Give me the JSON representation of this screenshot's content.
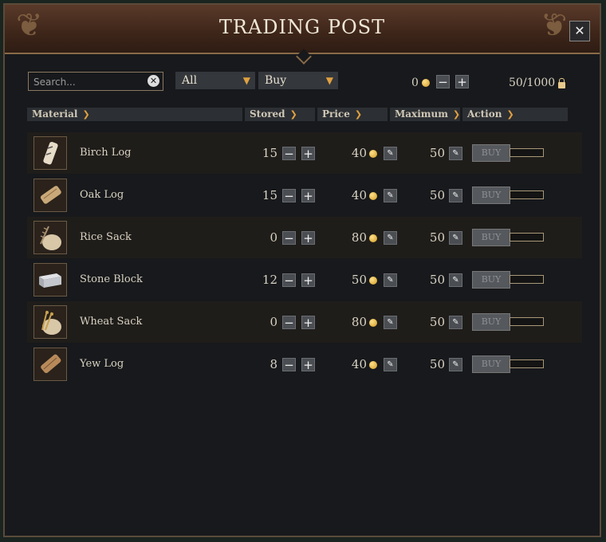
{
  "window": {
    "title": "TRADING POST",
    "close_label": "✕"
  },
  "filters": {
    "search_placeholder": "Search...",
    "search_value": "",
    "category": "All",
    "mode": "Buy"
  },
  "gold": {
    "amount": "0"
  },
  "capacity": {
    "text": "50/1000"
  },
  "columns": {
    "material": "Material",
    "stored": "Stored",
    "price": "Price",
    "maximum": "Maximum",
    "action": "Action"
  },
  "materials": [
    {
      "name": "Birch Log",
      "stored": "15",
      "price": "40",
      "maximum": "50",
      "action": "BUY",
      "slider_fraction": 0,
      "icon": "birch-log-icon"
    },
    {
      "name": "Oak Log",
      "stored": "15",
      "price": "40",
      "maximum": "50",
      "action": "BUY",
      "slider_fraction": 0,
      "icon": "oak-log-icon"
    },
    {
      "name": "Rice Sack",
      "stored": "0",
      "price": "80",
      "maximum": "50",
      "action": "BUY",
      "slider_fraction": 0,
      "icon": "rice-sack-icon"
    },
    {
      "name": "Stone Block",
      "stored": "12",
      "price": "50",
      "maximum": "50",
      "action": "BUY",
      "slider_fraction": 0,
      "icon": "stone-block-icon"
    },
    {
      "name": "Wheat Sack",
      "stored": "0",
      "price": "80",
      "maximum": "50",
      "action": "BUY",
      "slider_fraction": 0,
      "icon": "wheat-sack-icon"
    },
    {
      "name": "Yew Log",
      "stored": "8",
      "price": "40",
      "maximum": "50",
      "action": "BUY",
      "slider_fraction": 0,
      "icon": "yew-log-icon"
    }
  ],
  "colors": {
    "accent": "#e0a040",
    "title_bar": "#3d2519",
    "border": "#8a6a48"
  }
}
